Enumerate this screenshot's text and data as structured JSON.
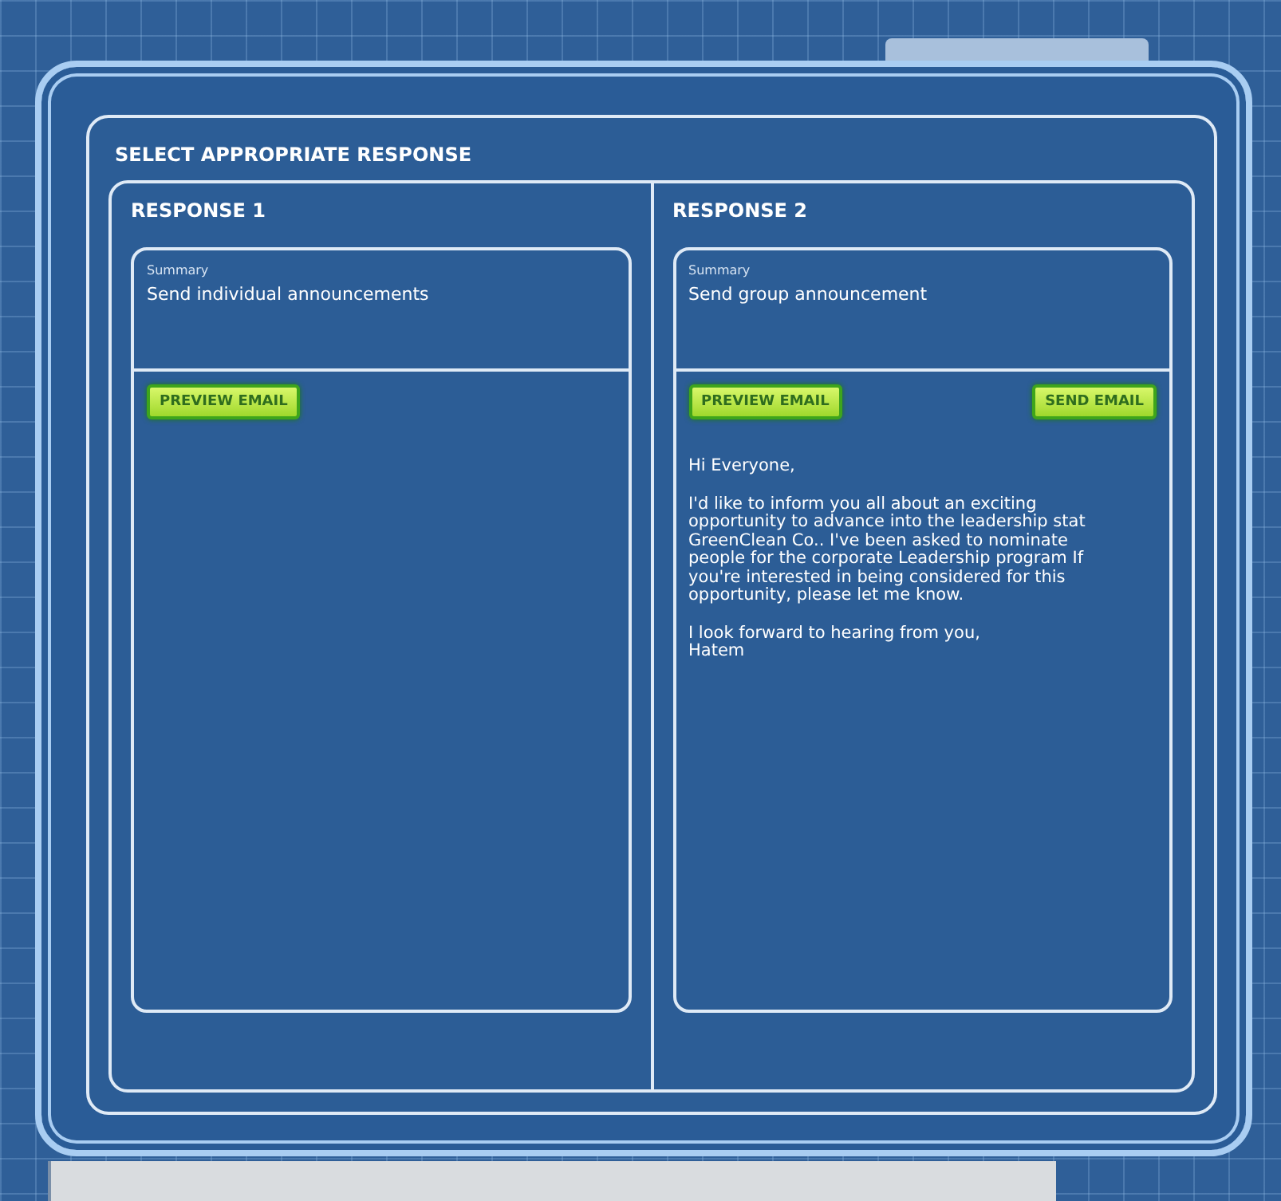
{
  "dialog": {
    "title": "SELECT APPROPRIATE RESPONSE"
  },
  "responses": [
    {
      "title": "RESPONSE 1",
      "summary_label": "Summary",
      "summary": "Send individual announcements",
      "buttons": [
        {
          "label": "PREVIEW EMAIL"
        }
      ]
    },
    {
      "title": "RESPONSE 2",
      "summary_label": "Summary",
      "summary": "Send group announcement",
      "buttons": [
        {
          "label": "PREVIEW EMAIL"
        },
        {
          "label": "SEND EMAIL"
        }
      ],
      "email": [
        "Hi Everyone,",
        "I'd like to inform you all about an exciting\nopportunity to advance into the leadership stat\nGreenClean Co.. I've been asked to nominate\npeople for the corporate Leadership program  If\nyou're interested in being considered for this\nopportunity, please let me know.",
        "I look forward to hearing from you,\nHatem"
      ]
    }
  ]
}
